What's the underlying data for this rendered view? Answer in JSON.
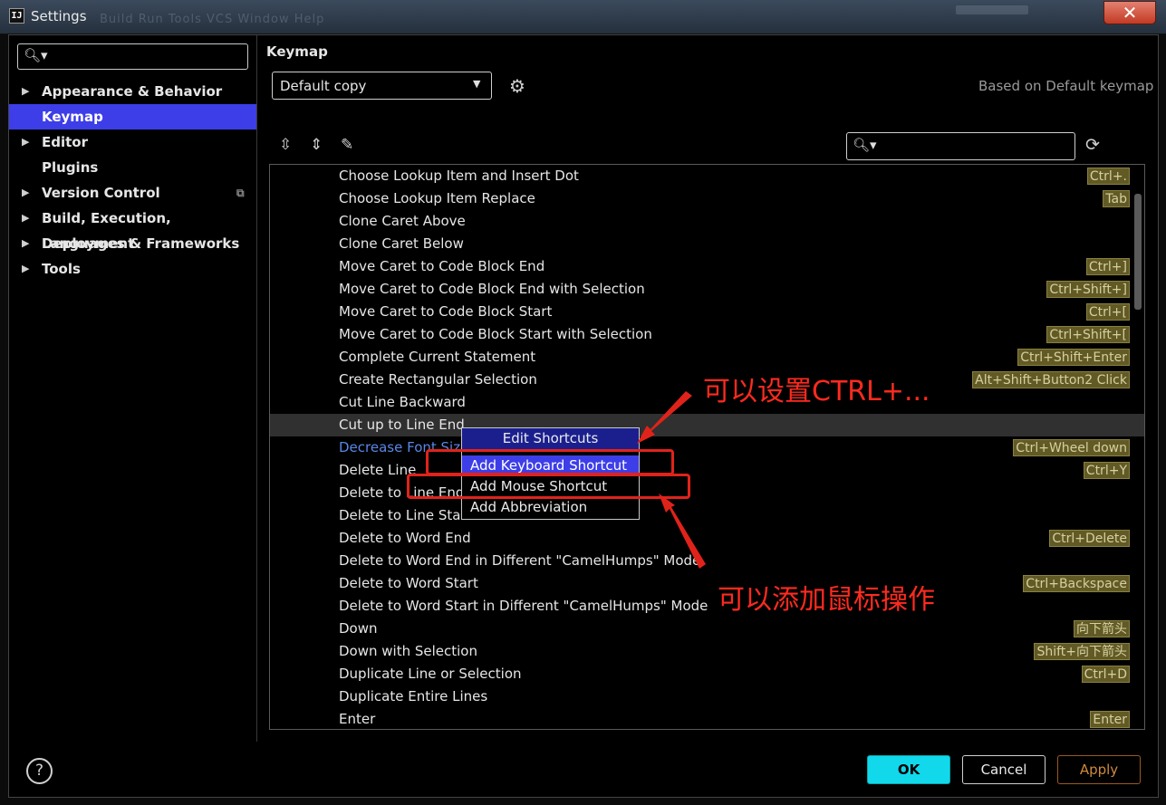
{
  "window": {
    "title": "Settings",
    "close_label": "✕",
    "ghost_menu": "Build  Run  Tools  VCS  Window  Help"
  },
  "sidebar": {
    "search_placeholder": "",
    "items": [
      {
        "label": "Appearance & Behavior",
        "expandable": true
      },
      {
        "label": "Keymap",
        "expandable": false,
        "selected": true
      },
      {
        "label": "Editor",
        "expandable": true
      },
      {
        "label": "Plugins",
        "expandable": false
      },
      {
        "label": "Version Control",
        "expandable": true
      },
      {
        "label": "Build, Execution, Deployment",
        "expandable": true
      },
      {
        "label": "Languages & Frameworks",
        "expandable": true
      },
      {
        "label": "Tools",
        "expandable": true
      }
    ]
  },
  "keymap": {
    "title": "Keymap",
    "scheme": "Default copy",
    "based_on": "Based on Default keymap",
    "search_placeholder": ""
  },
  "actions": [
    {
      "name": "Choose Lookup Item and Insert Dot",
      "shortcut": "Ctrl+."
    },
    {
      "name": "Choose Lookup Item Replace",
      "shortcut": "Tab"
    },
    {
      "name": "Clone Caret Above",
      "shortcut": ""
    },
    {
      "name": "Clone Caret Below",
      "shortcut": ""
    },
    {
      "name": "Move Caret to Code Block End",
      "shortcut": "Ctrl+]"
    },
    {
      "name": "Move Caret to Code Block End with Selection",
      "shortcut": "Ctrl+Shift+]"
    },
    {
      "name": "Move Caret to Code Block Start",
      "shortcut": "Ctrl+["
    },
    {
      "name": "Move Caret to Code Block Start with Selection",
      "shortcut": "Ctrl+Shift+["
    },
    {
      "name": "Complete Current Statement",
      "shortcut": "Ctrl+Shift+Enter"
    },
    {
      "name": "Create Rectangular Selection",
      "shortcut": "Alt+Shift+Button2 Click"
    },
    {
      "name": "Cut Line Backward",
      "shortcut": ""
    },
    {
      "name": "Cut up to Line End",
      "shortcut": "",
      "hover": true
    },
    {
      "name": "Decrease Font Size",
      "shortcut": "Ctrl+Wheel down",
      "link": true
    },
    {
      "name": "Delete Line",
      "shortcut": "Ctrl+Y"
    },
    {
      "name": "Delete to Line End",
      "shortcut": ""
    },
    {
      "name": "Delete to Line Start",
      "shortcut": ""
    },
    {
      "name": "Delete to Word End",
      "shortcut": "Ctrl+Delete"
    },
    {
      "name": "Delete to Word End in Different \"CamelHumps\" Mode",
      "shortcut": ""
    },
    {
      "name": "Delete to Word Start",
      "shortcut": "Ctrl+Backspace"
    },
    {
      "name": "Delete to Word Start in Different \"CamelHumps\" Mode",
      "shortcut": ""
    },
    {
      "name": "Down",
      "shortcut": "向下箭头"
    },
    {
      "name": "Down with Selection",
      "shortcut": "Shift+向下箭头"
    },
    {
      "name": "Duplicate Line or Selection",
      "shortcut": "Ctrl+D"
    },
    {
      "name": "Duplicate Entire Lines",
      "shortcut": ""
    },
    {
      "name": "Enter",
      "shortcut": "Enter"
    }
  ],
  "context_menu": {
    "header": "Edit Shortcuts",
    "items": [
      "Add Keyboard Shortcut",
      "Add Mouse Shortcut",
      "Add Abbreviation"
    ]
  },
  "annotations": {
    "keyboard_note": "可以设置CTRL+...",
    "mouse_note": "可以添加鼠标操作"
  },
  "footer": {
    "help": "?",
    "ok": "OK",
    "cancel": "Cancel",
    "apply": "Apply"
  },
  "colors": {
    "selection": "#3d3ee8",
    "ok_button": "#12d8ec",
    "annotation": "#e0231a",
    "shortcut_badge": "#615a25"
  }
}
